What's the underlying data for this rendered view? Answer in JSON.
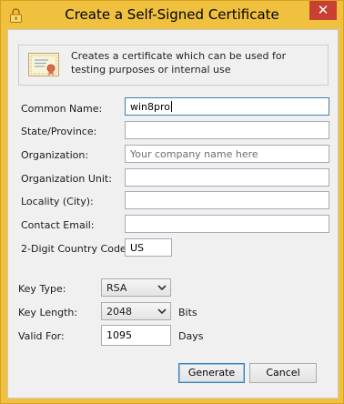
{
  "window": {
    "title": "Create a Self-Signed Certificate",
    "close_glyph": "✕",
    "lock_icon": "lock-icon",
    "title_bar_color": "#f0c03f",
    "close_button_color": "#c84031"
  },
  "banner": {
    "icon": "certificate-icon",
    "text": "Creates a certificate which can be used for testing purposes or internal use"
  },
  "form": {
    "common_name": {
      "label": "Common Name:",
      "value": "win8pro"
    },
    "state": {
      "label": "State/Province:",
      "value": ""
    },
    "organization": {
      "label": "Organization:",
      "value": "",
      "placeholder": "Your company name here"
    },
    "org_unit": {
      "label": "Organization Unit:",
      "value": ""
    },
    "locality": {
      "label": "Locality (City):",
      "value": ""
    },
    "email": {
      "label": "Contact Email:",
      "value": ""
    },
    "country": {
      "label": "2-Digit Country Code:",
      "value": "US"
    }
  },
  "key": {
    "type": {
      "label": "Key Type:",
      "value": "RSA"
    },
    "length": {
      "label": "Key Length:",
      "value": "2048",
      "unit": "Bits"
    },
    "valid": {
      "label": "Valid For:",
      "value": "1095",
      "unit": "Days"
    }
  },
  "buttons": {
    "generate": "Generate",
    "cancel": "Cancel"
  }
}
